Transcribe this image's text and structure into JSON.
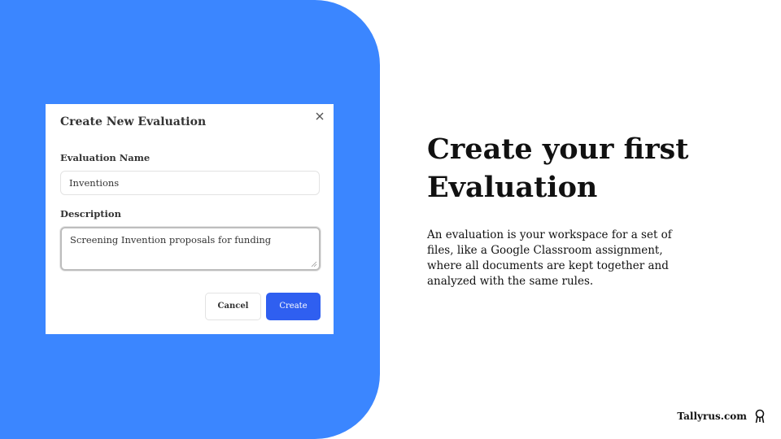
{
  "dialog": {
    "title": "Create New Evaluation",
    "name_label": "Evaluation Name",
    "name_value": "Inventions",
    "description_label": "Description",
    "description_value": "Screening Invention proposals for funding",
    "cancel_label": "Cancel",
    "create_label": "Create"
  },
  "hero": {
    "headline": "Create your first Evaluation",
    "body": "An evaluation is your workspace for a set of files, like a Google Classroom assignment, where all documents are kept together and analyzed with the same rules."
  },
  "brand": {
    "name": "Tallyrus.com",
    "icon": "tallyrus-logo-icon"
  },
  "colors": {
    "panel_blue": "#3b86ff",
    "create_button": "#2f5ff0"
  }
}
